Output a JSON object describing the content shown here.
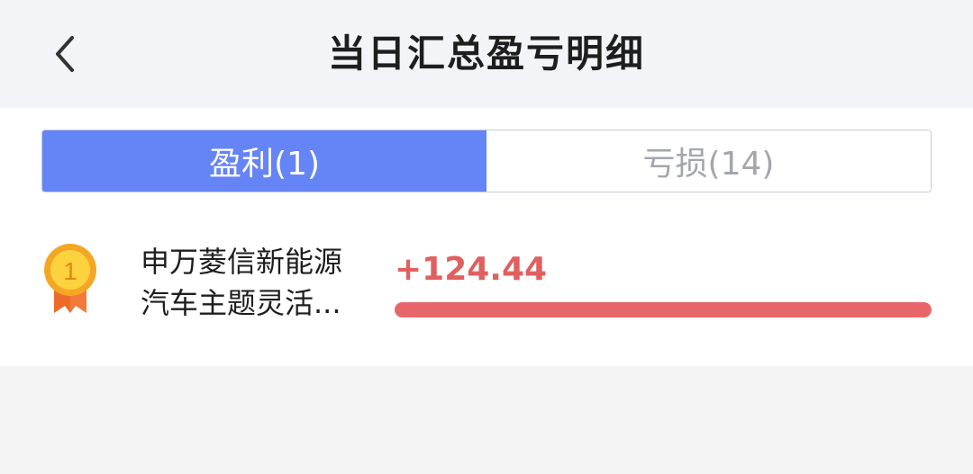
{
  "header": {
    "title": "当日汇总盈亏明细",
    "back_icon": "chevron-left-icon"
  },
  "tabs": [
    {
      "label": "盈利(1)",
      "active": true
    },
    {
      "label": "亏损(14)",
      "active": false
    }
  ],
  "items": [
    {
      "rank": "1",
      "rank_icon": "gold-medal-icon",
      "name_line1": "申万菱信新能源",
      "name_line2": "汽车主题灵活...",
      "amount": "+124.44",
      "bar_fraction": 1.0,
      "color": "#e8666a"
    }
  ]
}
